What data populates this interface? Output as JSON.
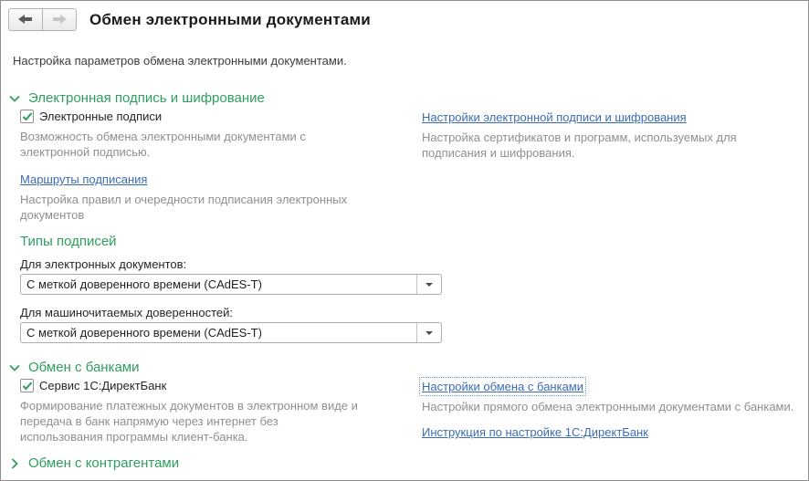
{
  "window": {
    "title": "Обмен электронными документами",
    "subtitle": "Настройка параметров обмена электронными документами."
  },
  "icons": {
    "back": "arrow-left",
    "forward": "arrow-right",
    "expanded": "chevron-down",
    "collapsed": "chevron-right",
    "checked": "green-checkmark",
    "combo": "dropdown-triangle"
  },
  "colors": {
    "accent_green": "#2E9E5E",
    "link_blue": "#3A6DB4",
    "muted_text": "#8f8f8f"
  },
  "sections": {
    "signature": {
      "title": "Электронная подпись и шифрование",
      "collapsed": false,
      "checkbox": {
        "label": "Электронные подписи",
        "checked": true
      },
      "checkbox_desc": "Возможность обмена электронными документами с\nэлектронной подписью.",
      "settings_link": "Настройки электронной подписи и шифрования",
      "settings_desc": "Настройка сертификатов и программ, используемых для\nподписания и шифрования.",
      "routes_link": "Маршруты подписания",
      "routes_desc": "Настройка правил и очередности подписания электронных\nдокументов",
      "types": {
        "title": "Типы подписей",
        "fields": [
          {
            "label": "Для электронных документов:",
            "value": "С меткой доверенного времени (CAdES-T)"
          },
          {
            "label": "Для машиночитаемых доверенностей:",
            "value": "С меткой доверенного времени (CAdES-T)"
          }
        ]
      }
    },
    "banks": {
      "title": "Обмен с банками",
      "collapsed": false,
      "checkbox": {
        "label": "Сервис 1С:ДиректБанк",
        "checked": true
      },
      "checkbox_desc": "Формирование платежных документов в электронном виде и\nпередача в банк напрямую через интернет без\nиспользования программы клиент-банка.",
      "settings_link": "Настройки обмена с банками",
      "settings_desc": "Настройки прямого обмена электронными документами с банками.",
      "instruction_link": "Инструкция по настройке 1С:ДиректБанк"
    },
    "counterparties": {
      "title": "Обмен с контрагентами",
      "collapsed": true
    }
  }
}
